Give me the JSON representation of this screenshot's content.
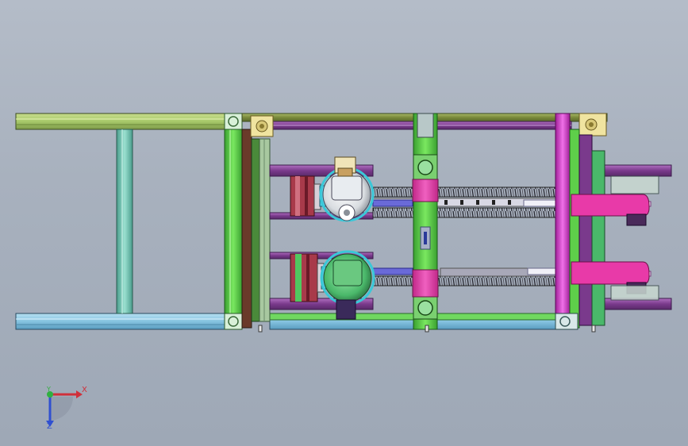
{
  "viewport": {
    "background_top": "#b4bcc8",
    "background_bottom": "#9ea8b6"
  },
  "colors": {
    "frame_top_rail": "#a7c96a",
    "frame_bottom_rail": "#86c3e0",
    "frame_green": "#5ecf4a",
    "frame_teal": "#6fc7b0",
    "frame_olive": "#7a8a3c",
    "frame_purple": "#7a3a8c",
    "frame_magenta": "#d43cc8",
    "pink_block": "#e83aa8",
    "motor_cyan": "#5ad0e8",
    "motor_green": "#4ab86a",
    "brake_red": "#a83a4a",
    "chain_dark": "#3a3a44",
    "slide_white": "#e8e8f0",
    "slide_blue": "#6a6ad8",
    "bracket_yellow": "#e8d890",
    "rail_purple_dark": "#8a3a9a"
  },
  "triad": {
    "x_label": "X",
    "y_label": "Y",
    "z_label": "Z",
    "x_color": "#d0303a",
    "y_color": "#30b040",
    "z_color": "#3050d0"
  }
}
